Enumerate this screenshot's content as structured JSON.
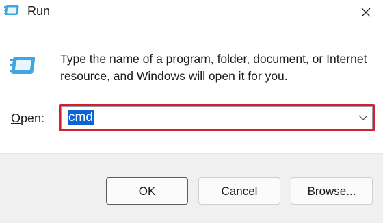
{
  "window": {
    "title": "Run",
    "title_icon": "run-dialog-icon",
    "close_icon": "close-icon"
  },
  "content": {
    "description": "Type the name of a program, folder, document, or Internet resource, and Windows will open it for you.",
    "icon": "run-dialog-icon"
  },
  "open_field": {
    "label_accel": "O",
    "label_rest": "pen:",
    "value": "cmd",
    "highlight_color": "#d21f33",
    "selection_color": "#0a64d6",
    "dropdown_icon": "chevron-down-icon"
  },
  "buttons": {
    "ok": "OK",
    "cancel": "Cancel",
    "browse_accel": "B",
    "browse_rest": "rowse..."
  }
}
